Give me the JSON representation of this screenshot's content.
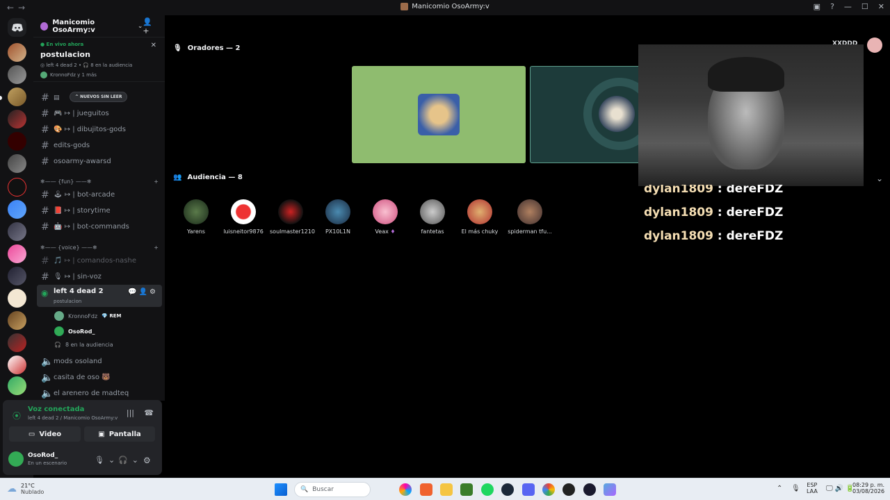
{
  "window": {
    "title": "Manicomio OsoArmy:v"
  },
  "server": {
    "name": "Manicomio OsoArmy:v"
  },
  "live": {
    "label": "En vivo ahora",
    "title": "postulacion",
    "sub": "left 4 dead 2 • 🎧 8 en la audiencia",
    "who": "KronnoFdz y 1 más"
  },
  "unread_label": "NUEVOS SIN LEER",
  "channels": [
    {
      "name": "🎮 ↦ | jueguitos"
    },
    {
      "name": "🎨 ↦ | dibujitos-gods"
    },
    {
      "name": "edits-gods"
    },
    {
      "name": "osoarmy-awarsd"
    },
    {
      "name": "🕹 ↦ | bot-arcade"
    },
    {
      "name": "📕 ↦ | storytime"
    },
    {
      "name": "🤖 ↦ | bot-commands"
    },
    {
      "name": "🎵 ↦ | comandos-nashe"
    },
    {
      "name": "🎙 ↦ | sin-voz"
    }
  ],
  "categories": {
    "fun": "❄—— {fun} ——❄",
    "voice": "❄—— {voice} ——❄"
  },
  "voice_channel": {
    "name": "left 4 dead 2",
    "sub": "postulacion",
    "users": [
      {
        "name": "KronnoFdz",
        "tag": "REM"
      },
      {
        "name": "OsoRod_"
      }
    ],
    "audience": "8 en la audiencia"
  },
  "voice_others": [
    {
      "name": "mods osoland"
    },
    {
      "name": "casita de oso 🐻"
    },
    {
      "name": "el arenero de madteq"
    }
  ],
  "panel": {
    "status": "Voz conectada",
    "location": "left 4 dead 2 / Manicomio OsoArmy:v",
    "video": "Video",
    "screen": "Pantalla",
    "user": "OsoRod_",
    "user_status": "En un escenario"
  },
  "stage": {
    "speakers_label": "Oradores — 2",
    "audience_label": "Audiencia — 8",
    "overlay_text": "XXDDD"
  },
  "audience": [
    "Yarens",
    "luisneitor9876",
    "soulmaster1210",
    "PX10L1N",
    "Veax",
    "fantetas",
    "El más chuky",
    "spiderman tfu..."
  ],
  "chat": [
    {
      "user": "dylan1809",
      "msg": "dereFDZ"
    },
    {
      "user": "dylan1809",
      "msg": "dereFDZ"
    },
    {
      "user": "dylan1809",
      "msg": "dereFDZ"
    }
  ],
  "taskbar": {
    "weather_temp": "21°C",
    "weather_desc": "Nublado",
    "search": "Buscar",
    "lang1": "ESP",
    "lang2": "LAA",
    "time": "08:29 p. m.",
    "date": "03/08/2026"
  },
  "colors": {
    "accent": "#23a55a",
    "bg": "#121214",
    "speaker_green": "#8fbc6f",
    "speaker_teal": "#1d3b3a"
  }
}
